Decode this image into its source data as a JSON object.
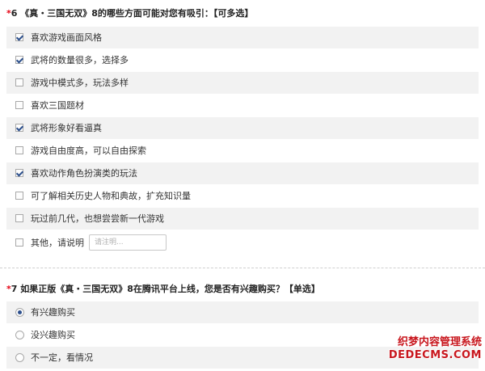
{
  "q6": {
    "required_mark": "*",
    "title": "6 《真・三国无双》8的哪些方面可能对您有吸引：【可多选】",
    "options": [
      {
        "label": "喜欢游戏画面风格",
        "checked": true
      },
      {
        "label": "武将的数量很多，选择多",
        "checked": true
      },
      {
        "label": "游戏中模式多，玩法多样",
        "checked": false
      },
      {
        "label": "喜欢三国题材",
        "checked": false
      },
      {
        "label": "武将形象好看逼真",
        "checked": true
      },
      {
        "label": "游戏自由度高，可以自由探索",
        "checked": false
      },
      {
        "label": "喜欢动作角色扮演类的玩法",
        "checked": true
      },
      {
        "label": "可了解相关历史人物和典故，扩充知识量",
        "checked": false
      },
      {
        "label": "玩过前几代，也想尝尝新一代游戏",
        "checked": false
      },
      {
        "label": "其他，请说明",
        "checked": false
      }
    ],
    "other_placeholder": "请注明..."
  },
  "q7": {
    "required_mark": "*",
    "title": "7 如果正版《真・三国无双》8在腾讯平台上线，您是否有兴趣购买？【单选】",
    "options": [
      {
        "label": "有兴趣购买",
        "selected": true
      },
      {
        "label": "没兴趣购买",
        "selected": false
      },
      {
        "label": "不一定，看情况",
        "selected": false
      }
    ]
  },
  "watermark": {
    "top": "织梦内容管理系统",
    "bottom": "DEDECMS.COM"
  },
  "colors": {
    "required": "#e60012",
    "check": "#2c4f8c",
    "row_shade": "#f2f2f2",
    "watermark": "#c8161d"
  }
}
